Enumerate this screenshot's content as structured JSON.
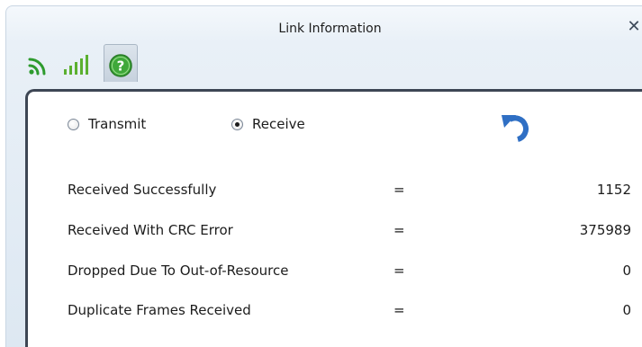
{
  "window": {
    "title": "Link Information"
  },
  "tabs": [
    {
      "name": "link-status",
      "icon": "wifi-link-icon",
      "color": "#2e9b2e"
    },
    {
      "name": "signal",
      "icon": "signal-strength-icon",
      "color": "#5bb030"
    },
    {
      "name": "statistics",
      "icon": "help-question-icon",
      "color": "#3fa83a",
      "selected": true
    }
  ],
  "mode": {
    "options": [
      {
        "label": "Transmit",
        "checked": false
      },
      {
        "label": "Receive",
        "checked": true
      }
    ]
  },
  "stats": [
    {
      "label": "Received Successfully",
      "eq": "=",
      "value": "1152"
    },
    {
      "label": "Received With CRC Error",
      "eq": "=",
      "value": "375989"
    },
    {
      "label": "Dropped Due To Out-of-Resource",
      "eq": "=",
      "value": "0"
    },
    {
      "label": "Duplicate Frames Received",
      "eq": "=",
      "value": "0"
    }
  ],
  "colors": {
    "accent": "#2f6fc4",
    "panel_border": "#3d4654"
  }
}
